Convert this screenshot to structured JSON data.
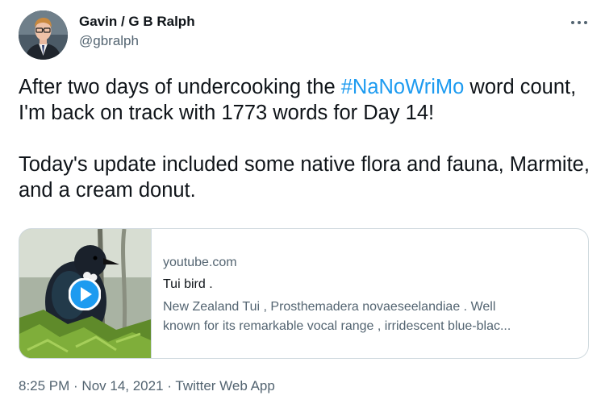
{
  "author": {
    "display_name": "Gavin / G B Ralph",
    "handle": "@gbralph"
  },
  "tweet": {
    "line1_before": "After two days of undercooking the ",
    "hashtag": "#NaNoWriMo",
    "line1_after": " word count, I'm back on track with 1773 words for Day 14!",
    "paragraph2": "Today's update included some native flora and fauna, Marmite, and a cream donut."
  },
  "card": {
    "domain": "youtube.com",
    "title": "Tui bird .",
    "description_line1": "New Zealand Tui , Prosthemadera novaeseelandiae . Well",
    "description_line2": "known for its remarkable vocal range , irridescent blue-blac...",
    "play_icon": "play-icon"
  },
  "meta": {
    "time": "8:25 PM",
    "sep1": " · ",
    "date": "Nov 14, 2021",
    "sep2": " · ",
    "source": "Twitter Web App"
  },
  "colors": {
    "accent": "#1d9bf0",
    "text": "#0f1419",
    "secondary": "#536471",
    "border": "#cfd9de"
  }
}
